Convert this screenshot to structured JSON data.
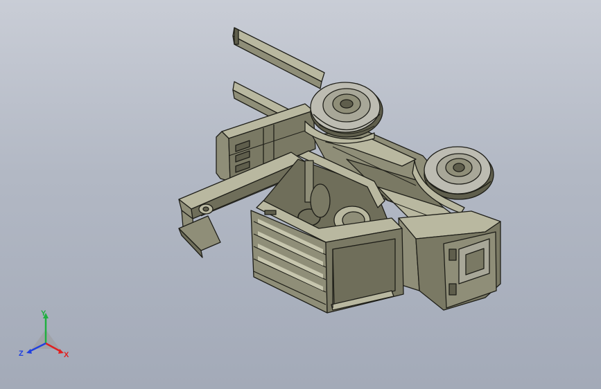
{
  "triad": {
    "x_label": "X",
    "y_label": "Y",
    "z_label": "Z",
    "x_color": "#e02020",
    "y_color": "#20b040",
    "z_color": "#2040e0"
  },
  "model": {
    "body_color": "#8f8e78",
    "edge_color": "#1e1e18",
    "light_color": "#b9b8a0",
    "dark_color": "#5f5e4c",
    "tire_color": "#bdbcb2"
  }
}
